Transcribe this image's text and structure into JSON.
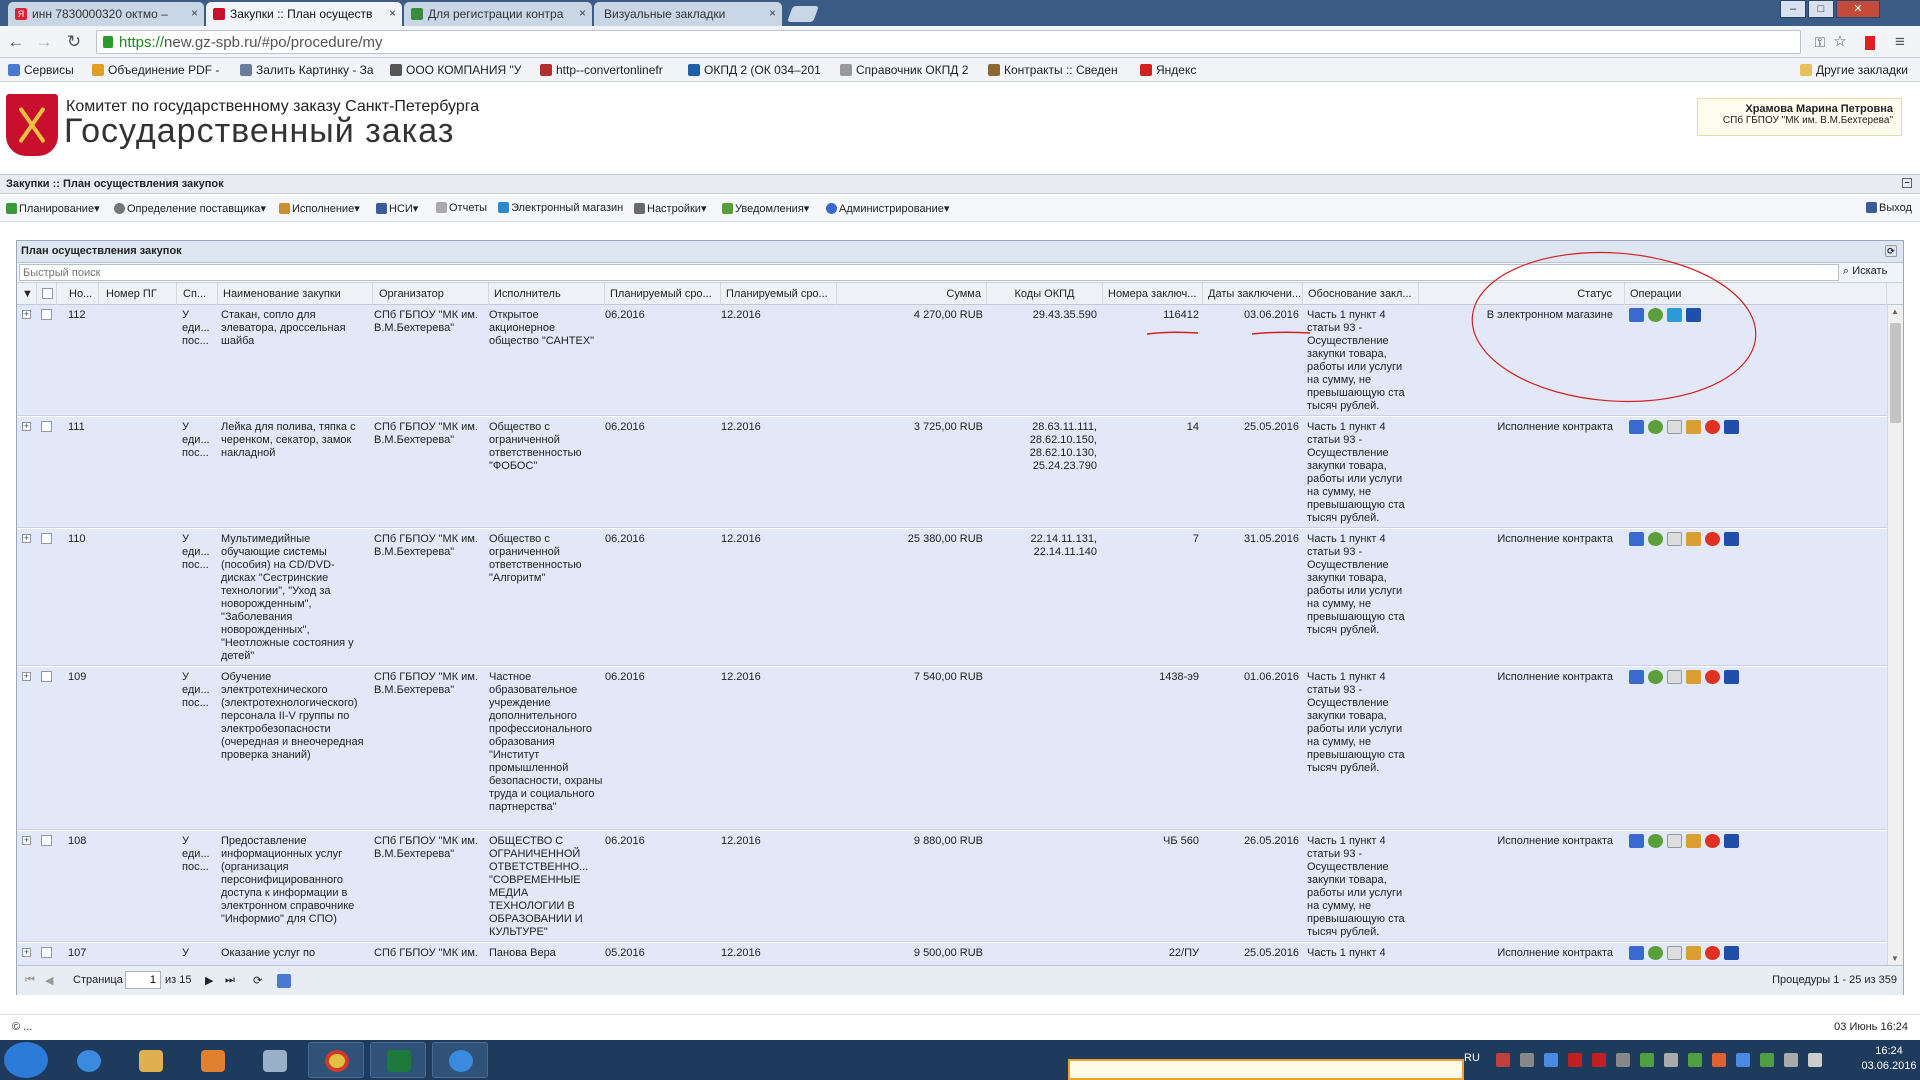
{
  "browser": {
    "tabs": [
      {
        "title": "инн 7830000320 октмо –"
      },
      {
        "title": "Закупки :: План осуществ"
      },
      {
        "title": "Для регистрации контра"
      },
      {
        "title": "Визуальные закладки"
      }
    ],
    "url_scheme": "https://",
    "url_rest": "new.gz-spb.ru/#po/procedure/my",
    "bookmarks": [
      "Сервисы",
      "Объединение PDF -",
      "Залить Картинку - За",
      "ООО КОМПАНИЯ \"У",
      "http--convertonlinefr",
      "ОКПД 2 (ОК 034–201",
      "Справочник ОКПД 2",
      "Контракты :: Сведен",
      "Яндекс"
    ],
    "other_bookmarks": "Другие закладки"
  },
  "site": {
    "org_name": "Комитет по государственному заказу Санкт-Петербурга",
    "site_name": "Государственный заказ",
    "user_name": "Храмова Марина Петровна",
    "user_org": "СПб ГБПОУ \"МК им. В.М.Бехтерева\""
  },
  "panel": {
    "title": "Закупки :: План осуществления закупок"
  },
  "menu": {
    "items": [
      "Планирование",
      "Определение поставщика",
      "Исполнение",
      "НСИ",
      "Отчеты",
      "Электронный магазин",
      "Настройки",
      "Уведомления",
      "Администрирование"
    ],
    "exit": "Выход"
  },
  "grid": {
    "title": "План осуществления закупок",
    "search_placeholder": "Быстрый поиск",
    "search_button": "Искать",
    "columns": [
      "Но...",
      "Номер ПГ",
      "Сп...",
      "Наименование закупки",
      "Организатор",
      "Исполнитель",
      "Планируемый сро...",
      "Планируемый сро...",
      "Сумма",
      "Коды ОКПД",
      "Номера заключ...",
      "Даты заключени...",
      "Обоснование закл...",
      "Статус",
      "Операции"
    ],
    "rows": [
      {
        "no": "112",
        "method": "У\nеди...\nпос...",
        "name": "Стакан, сопло для элеватора, дроссельная шайба",
        "organizer": "СПб ГБПОУ \"МК им. В.М.Бехтерева\"",
        "executor": "Открытое акционерное общество \"САНТЕХ\"",
        "start": "06.2016",
        "end": "12.2016",
        "sum": "4 270,00 RUB",
        "okpd": "29.43.35.590",
        "contract_no": "116412",
        "contract_date": "03.06.2016",
        "basis": "Часть 1 пункт 4 статьи 93 - Осуществление закупки товара, работы или услуги на сумму, не превышающую ста тысяч рублей.",
        "status": "В электронном магазине"
      },
      {
        "no": "111",
        "method": "У\nеди...\nпос...",
        "name": "Лейка для полива, тяпка с черенком, секатор, замок накладной",
        "organizer": "СПб ГБПОУ \"МК им. В.М.Бехтерева\"",
        "executor": "Общество с ограниченной ответственностью \"ФОБОС\"",
        "start": "06.2016",
        "end": "12.2016",
        "sum": "3 725,00 RUB",
        "okpd": "28.63.11.111,\n28.62.10.150,\n28.62.10.130,\n25.24.23.790",
        "contract_no": "14",
        "contract_date": "25.05.2016",
        "basis": "Часть 1 пункт 4 статьи 93 - Осуществление закупки товара, работы или услуги на сумму, не превышающую ста тысяч рублей.",
        "status": "Исполнение контракта"
      },
      {
        "no": "110",
        "method": "У\nеди...\nпос...",
        "name": "Мультимедийные обучающие системы (пособия) на CD/DVD-дисках \"Сестринские технологии\", \"Уход за новорожденным\", \"Заболевания новорожденных\", \"Неотложные состояния у детей\"",
        "organizer": "СПб ГБПОУ \"МК им. В.М.Бехтерева\"",
        "executor": "Общество с ограниченной ответственностью \"Алгоритм\"",
        "start": "06.2016",
        "end": "12.2016",
        "sum": "25 380,00 RUB",
        "okpd": "22.14.11.131,\n22.14.11.140",
        "contract_no": "7",
        "contract_date": "31.05.2016",
        "basis": "Часть 1 пункт 4 статьи 93 - Осуществление закупки товара, работы или услуги на сумму, не превышающую ста тысяч рублей.",
        "status": "Исполнение контракта"
      },
      {
        "no": "109",
        "method": "У\nеди...\nпос...",
        "name": "Обучение электротехнического (электротехнологического) персонала II-V группы по электробезопасности (очередная и внеочередная проверка знаний)",
        "organizer": "СПб ГБПОУ \"МК им. В.М.Бехтерева\"",
        "executor": "Частное образовательное учреждение дополнительного профессионального образования \"Институт промышленной безопасности, охраны труда и социального партнерства\"",
        "start": "06.2016",
        "end": "12.2016",
        "sum": "7 540,00 RUB",
        "okpd": "",
        "contract_no": "1438-э9",
        "contract_date": "01.06.2016",
        "basis": "Часть 1 пункт 4 статьи 93 - Осуществление закупки товара, работы или услуги на сумму, не превышающую ста тысяч рублей.",
        "status": "Исполнение контракта"
      },
      {
        "no": "108",
        "method": "У\nеди...\nпос...",
        "name": "Предоставление информационных услуг (организация персонифицированного доступа к информации в электронном справочнике \"Информио\" для СПО)",
        "organizer": "СПб ГБПОУ \"МК им. В.М.Бехтерева\"",
        "executor": "ОБЩЕСТВО С ОГРАНИЧЕННОЙ ОТВЕТСТВЕННО... \"СОВРЕМЕННЫЕ МЕДИА ТЕХНОЛОГИИ В ОБРАЗОВАНИИ И КУЛЬТУРЕ\"",
        "start": "06.2016",
        "end": "12.2016",
        "sum": "9 880,00 RUB",
        "okpd": "",
        "contract_no": "ЧБ 560",
        "contract_date": "26.05.2016",
        "basis": "Часть 1 пункт 4 статьи 93 - Осуществление закупки товара, работы или услуги на сумму, не превышающую ста тысяч рублей.",
        "status": "Исполнение контракта"
      },
      {
        "no": "107",
        "method": "У",
        "name": "Оказание услуг по",
        "organizer": "СПб ГБПОУ \"МК им.",
        "executor": "Панова Вера",
        "start": "05.2016",
        "end": "12.2016",
        "sum": "9 500,00 RUB",
        "okpd": "",
        "contract_no": "22/ПУ",
        "contract_date": "25.05.2016",
        "basis": "Часть 1 пункт 4",
        "status": "Исполнение контракта"
      }
    ]
  },
  "pager": {
    "page_label": "Страница",
    "page_value": "1",
    "of_label": "из 15",
    "summary": "Процедуры 1 - 25 из 359"
  },
  "statusbar": {
    "left": "© ...",
    "right": "03 Июнь 16:24"
  },
  "taskbar": {
    "lang": "RU",
    "time": "16:24",
    "date": "03.06.2016"
  },
  "colors": {
    "row_bg": "#e3e8f8",
    "accent_red": "#c8102e",
    "annotation_red": "#d42020"
  }
}
